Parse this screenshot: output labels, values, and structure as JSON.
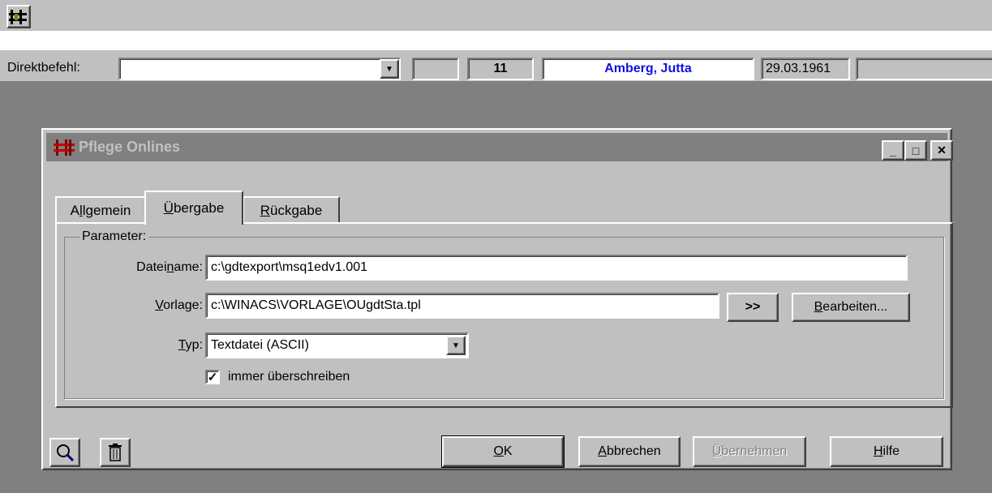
{
  "toolbar": {
    "app_icon": "abacus-icon"
  },
  "command_bar": {
    "label": "Direktbefehl:",
    "command_value": "",
    "field_number": "11",
    "patient_name": "Amberg, Jutta",
    "birth_date": "29.03.1961",
    "name_color": "#1010e0"
  },
  "dialog": {
    "title": "Pflege Onlines",
    "title_icon": "abacus-icon",
    "caption_buttons": {
      "minimize": "_",
      "maximize": "□",
      "close": "✕"
    },
    "tabs": [
      {
        "label_pre": "A",
        "label_ul": "l",
        "label_post": "lgemein",
        "active": false
      },
      {
        "label_pre": "",
        "label_ul": "Ü",
        "label_post": "bergabe",
        "active": true
      },
      {
        "label_pre": "",
        "label_ul": "R",
        "label_post": "ückgabe",
        "active": false
      }
    ],
    "group_title": "Parameter:",
    "fields": {
      "dateiname": {
        "label_pre": "Datei",
        "label_ul": "n",
        "label_post": "ame:",
        "value": "c:\\gdtexport\\msq1edv1.001"
      },
      "vorlage": {
        "label_pre": "",
        "label_ul": "V",
        "label_post": "orlage:",
        "value": "c:\\WINACS\\VORLAGE\\OUgdtSta.tpl"
      },
      "typ": {
        "label_pre": "",
        "label_ul": "T",
        "label_post": "yp:",
        "value": "Textdatei (ASCII)"
      }
    },
    "browse_button": ">>",
    "edit_button": {
      "pre": "",
      "ul": "B",
      "post": "earbeiten..."
    },
    "checkbox": {
      "label": "immer überschreiben",
      "checked": true,
      "mark": "✓"
    },
    "buttons": {
      "ok": {
        "pre": "",
        "ul": "O",
        "post": "K"
      },
      "cancel": {
        "pre": "",
        "ul": "A",
        "post": "bbrechen"
      },
      "apply": {
        "pre": "",
        "ul": "Ü",
        "post": "bernehmen",
        "enabled": false
      },
      "help": {
        "pre": "",
        "ul": "H",
        "post": "ilfe"
      }
    },
    "tool_icons": [
      "magnifier-icon",
      "trash-icon"
    ]
  }
}
